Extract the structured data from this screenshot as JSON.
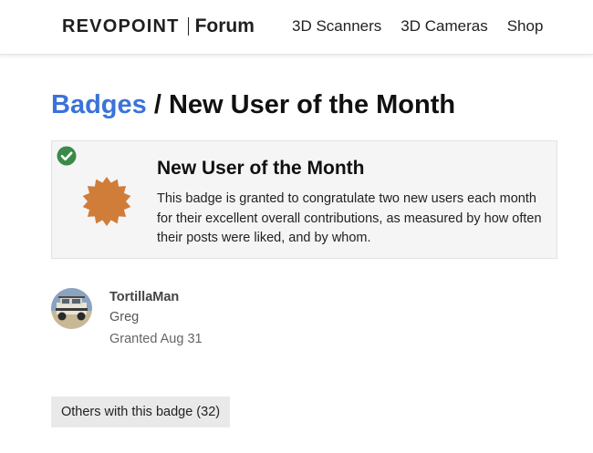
{
  "header": {
    "logo_brand": "REVOPOINT",
    "logo_section": "Forum",
    "nav": [
      {
        "label": "3D Scanners"
      },
      {
        "label": "3D Cameras"
      },
      {
        "label": "Shop"
      }
    ]
  },
  "title": {
    "breadcrumb": "Badges",
    "separator": " / ",
    "current": "New User of the Month"
  },
  "badge": {
    "name": "New User of the Month",
    "description": "This badge is granted to congratulate two new users each month for their excellent overall contributions, as measured by how often their posts were liked, and by whom.",
    "granted_icon": "check-circle-icon",
    "badge_icon": "bronze-badge-icon",
    "colors": {
      "badge": "#d07d3a",
      "check": "#3b8a4a",
      "link": "#3b73d9"
    }
  },
  "user": {
    "username": "TortillaMan",
    "full_name": "Greg",
    "granted": "Granted Aug 31"
  },
  "others_button": {
    "label": "Others with this badge (32)"
  }
}
